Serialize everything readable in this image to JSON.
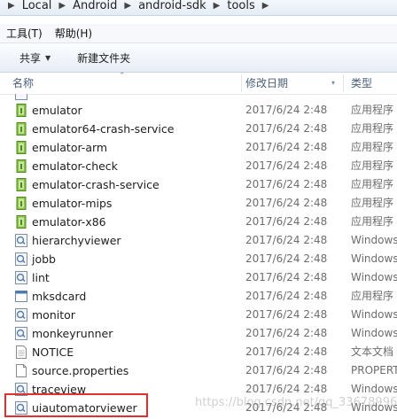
{
  "breadcrumb": [
    "Local",
    "Android",
    "android-sdk",
    "tools"
  ],
  "menu": [
    "工具(T)",
    "帮助(H)"
  ],
  "toolbar": {
    "share": "共享",
    "new_folder": "新建文件夹"
  },
  "columns": {
    "name": "名称",
    "date": "修改日期",
    "type": "类型"
  },
  "files": [
    {
      "name": "emulator",
      "date": "2017/6/24 2:48",
      "type": "应用程序",
      "icon": "exe-icon"
    },
    {
      "name": "emulator64-crash-service",
      "date": "2017/6/24 2:48",
      "type": "应用程序",
      "icon": "exe-icon"
    },
    {
      "name": "emulator-arm",
      "date": "2017/6/24 2:48",
      "type": "应用程序",
      "icon": "exe-icon"
    },
    {
      "name": "emulator-check",
      "date": "2017/6/24 2:48",
      "type": "应用程序",
      "icon": "exe-icon"
    },
    {
      "name": "emulator-crash-service",
      "date": "2017/6/24 2:48",
      "type": "应用程序",
      "icon": "exe-icon"
    },
    {
      "name": "emulator-mips",
      "date": "2017/6/24 2:48",
      "type": "应用程序",
      "icon": "exe-icon"
    },
    {
      "name": "emulator-x86",
      "date": "2017/6/24 2:48",
      "type": "应用程序",
      "icon": "exe-icon"
    },
    {
      "name": "hierarchyviewer",
      "date": "2017/6/24 2:48",
      "type": "Windows",
      "icon": "batch-icon"
    },
    {
      "name": "jobb",
      "date": "2017/6/24 2:48",
      "type": "Windows",
      "icon": "batch-icon"
    },
    {
      "name": "lint",
      "date": "2017/6/24 2:48",
      "type": "Windows",
      "icon": "batch-icon"
    },
    {
      "name": "mksdcard",
      "date": "2017/6/24 2:48",
      "type": "应用程序",
      "icon": "app-window-icon"
    },
    {
      "name": "monitor",
      "date": "2017/6/24 2:48",
      "type": "Windows",
      "icon": "batch-icon"
    },
    {
      "name": "monkeyrunner",
      "date": "2017/6/24 2:48",
      "type": "Windows",
      "icon": "batch-icon"
    },
    {
      "name": "NOTICE",
      "date": "2017/6/24 2:48",
      "type": "文本文档",
      "icon": "text-file-icon"
    },
    {
      "name": "source.properties",
      "date": "2017/6/24 2:48",
      "type": "PROPERT",
      "icon": "blank-file-icon"
    },
    {
      "name": "traceview",
      "date": "2017/6/24 2:48",
      "type": "Windows",
      "icon": "batch-icon"
    },
    {
      "name": "uiautomatorviewer",
      "date": "2017/6/24 2:48",
      "type": "Windows",
      "icon": "batch-icon"
    }
  ],
  "watermark": "https://blog.csdn.net/qq_33678996"
}
